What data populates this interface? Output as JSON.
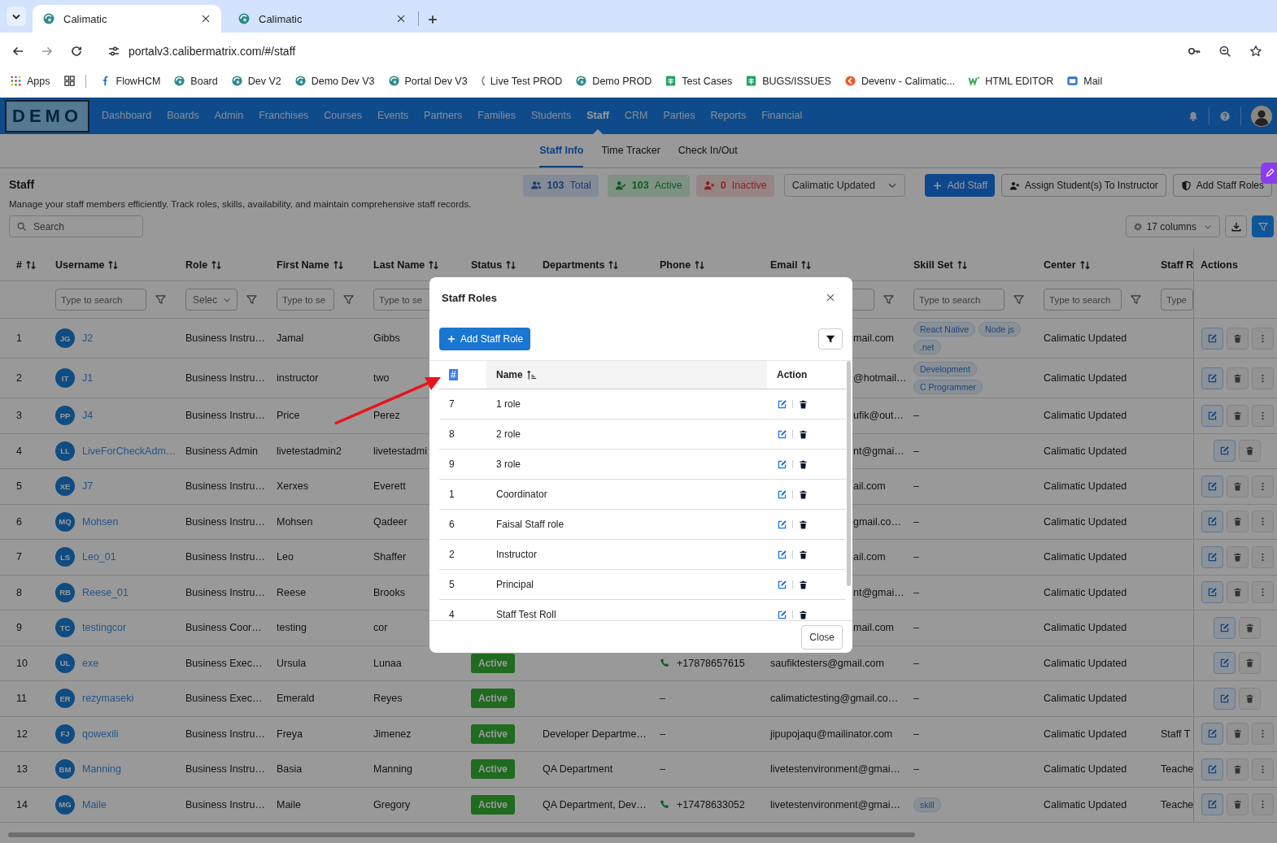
{
  "browser": {
    "tabs": [
      {
        "title": "Calimatic",
        "selected": true
      },
      {
        "title": "Calimatic",
        "selected": false
      }
    ],
    "url": "portalv3.calibermatrix.com/#/staff",
    "bookmarks": [
      {
        "kind": "apps",
        "label": "Apps"
      },
      {
        "kind": "grid"
      },
      {
        "kind": "flow",
        "label": "FlowHCM"
      },
      {
        "kind": "calimatic",
        "label": "Board"
      },
      {
        "kind": "calimatic",
        "label": "Dev V2"
      },
      {
        "kind": "calimatic",
        "label": "Demo Dev V3"
      },
      {
        "kind": "calimatic",
        "label": "Portal Dev V3"
      },
      {
        "kind": "sliver",
        "label": "Live Test PROD"
      },
      {
        "kind": "calimatic",
        "label": "Demo PROD"
      },
      {
        "kind": "sheet",
        "label": "Test Cases"
      },
      {
        "kind": "sheet",
        "label": "BUGS/ISSUES"
      },
      {
        "kind": "devenv",
        "label": "Devenv - Calimatic..."
      },
      {
        "kind": "editor",
        "label": "HTML EDITOR"
      },
      {
        "kind": "mail",
        "label": "Mail"
      }
    ]
  },
  "nav": {
    "logo": "DEMO",
    "items": [
      {
        "label": "Dashboard",
        "selected": false
      },
      {
        "label": "Boards",
        "selected": false
      },
      {
        "label": "Admin",
        "selected": false
      },
      {
        "label": "Franchises",
        "selected": false
      },
      {
        "label": "Courses",
        "selected": false
      },
      {
        "label": "Events",
        "selected": false
      },
      {
        "label": "Partners",
        "selected": false
      },
      {
        "label": "Families",
        "selected": false
      },
      {
        "label": "Students",
        "selected": false
      },
      {
        "label": "Staff",
        "selected": true
      },
      {
        "label": "CRM",
        "selected": false
      },
      {
        "label": "Parties",
        "selected": false
      },
      {
        "label": "Reports",
        "selected": false
      },
      {
        "label": "Financial",
        "selected": false
      }
    ]
  },
  "subtabs": [
    {
      "label": "Staff Info",
      "selected": true
    },
    {
      "label": "Time Tracker",
      "selected": false
    },
    {
      "label": "Check In/Out",
      "selected": false
    }
  ],
  "header": {
    "title": "Staff",
    "description": "Manage your staff members efficiently. Track roles, skills, availability, and maintain comprehensive staff records.",
    "stats": [
      {
        "kind": "total",
        "value": "103",
        "label": "Total"
      },
      {
        "kind": "active",
        "value": "103",
        "label": "Active"
      },
      {
        "kind": "inactive",
        "value": "0",
        "label": "Inactive"
      }
    ],
    "center_select": "Calimatic Updated",
    "buttons": [
      {
        "kind": "primary",
        "label": "Add Staff"
      },
      {
        "kind": "assign",
        "label": "Assign Student(s) To Instructor"
      },
      {
        "kind": "roles",
        "label": "Add Staff Roles"
      }
    ]
  },
  "toolbar": {
    "search_placeholder": "Search",
    "columns_label": "17 columns"
  },
  "table": {
    "columns": [
      {
        "label": "#",
        "sortable": true
      },
      {
        "label": "Username",
        "sortable": true
      },
      {
        "label": "Role",
        "sortable": true
      },
      {
        "label": "First Name",
        "sortable": true
      },
      {
        "label": "Last Name",
        "sortable": true
      },
      {
        "label": "Status",
        "sortable": true
      },
      {
        "label": "Departments",
        "sortable": true
      },
      {
        "label": "Phone",
        "sortable": true
      },
      {
        "label": "Email",
        "sortable": true
      },
      {
        "label": "Skill Set",
        "sortable": true
      },
      {
        "label": "Center",
        "sortable": true
      },
      {
        "label": "Staff R",
        "sortable": false
      },
      {
        "label": "Actions",
        "sortable": false
      }
    ],
    "filters": [
      {
        "kind": "none"
      },
      {
        "kind": "input",
        "placeholder": "Type to search"
      },
      {
        "kind": "select",
        "placeholder": "Selec"
      },
      {
        "kind": "input",
        "placeholder": "Type to se"
      },
      {
        "kind": "field",
        "placeholder": "Type to se"
      },
      {
        "kind": "none"
      },
      {
        "kind": "none"
      },
      {
        "kind": "none"
      },
      {
        "kind": "input"
      },
      {
        "kind": "input",
        "placeholder": "Type to search"
      },
      {
        "kind": "input",
        "placeholder": "Type to search"
      },
      {
        "kind": "bare",
        "placeholder": "Type"
      },
      {
        "kind": "none"
      }
    ],
    "rows": [
      {
        "num": "1",
        "initials": "JG",
        "username": "J2",
        "role": "Business Instru…",
        "first_name": "Jamal",
        "last_name": "Gibbs",
        "email": "mail.com",
        "skills": {
          "kind": "tags",
          "tags": [
            "React Native",
            "Node js",
            ".net"
          ]
        },
        "center": "Calimatic Updated",
        "more": true
      },
      {
        "num": "2",
        "initials": "IT",
        "username": "J1",
        "role": "Business Instru…",
        "first_name": "instructor",
        "last_name": "two",
        "email": "@hotmail…",
        "skills": {
          "kind": "tags",
          "tags": [
            "Development",
            "C Programmer"
          ]
        },
        "center": "Calimatic Updated",
        "more": true
      },
      {
        "num": "3",
        "initials": "PP",
        "username": "J4",
        "role": "Business Instru…",
        "first_name": "Price",
        "last_name": "Perez",
        "email": "ufik@out…",
        "skills": {
          "kind": "text",
          "text": "–"
        },
        "center": "Calimatic Updated",
        "more": true
      },
      {
        "num": "4",
        "initials": "LL",
        "username": "LiveForCheckAdm…",
        "role": "Business Admin",
        "first_name": "livetestadmin2",
        "last_name": "livetestadmi",
        "email": "nt@gmai…",
        "skills": {
          "kind": "text",
          "text": "–"
        },
        "center": "Calimatic Updated",
        "more": false
      },
      {
        "num": "5",
        "initials": "XE",
        "username": "J7",
        "role": "Business Instru…",
        "first_name": "Xerxes",
        "last_name": "Everett",
        "email": "ail.com",
        "skills": {
          "kind": "text",
          "text": "–"
        },
        "center": "Calimatic Updated",
        "more": true
      },
      {
        "num": "6",
        "initials": "MQ",
        "username": "Mohsen",
        "role": "Business Instru…",
        "first_name": "Mohsen",
        "last_name": "Qadeer",
        "email": "gmail.co…",
        "skills": {
          "kind": "text",
          "text": "–"
        },
        "center": "Calimatic Updated",
        "more": true
      },
      {
        "num": "7",
        "initials": "LS",
        "username": "Leo_01",
        "role": "Business Instru…",
        "first_name": "Leo",
        "last_name": "Shaffer",
        "email": "ail.com",
        "skills": {
          "kind": "text",
          "text": "–"
        },
        "center": "Calimatic Updated",
        "more": true
      },
      {
        "num": "8",
        "initials": "RB",
        "username": "Reese_01",
        "role": "Business Instru…",
        "first_name": "Reese",
        "last_name": "Brooks",
        "email": "nt@gmai…",
        "skills": {
          "kind": "text",
          "text": "–"
        },
        "center": "Calimatic Updated",
        "more": true
      },
      {
        "num": "9",
        "initials": "TC",
        "username": "testingcor",
        "role": "Business Coor…",
        "first_name": "testing",
        "last_name": "cor",
        "email": "mail.com",
        "skills": {
          "kind": "text",
          "text": "–"
        },
        "center": "Calimatic Updated",
        "more": false
      },
      {
        "num": "10",
        "initials": "UL",
        "username": "exe",
        "role": "Business Exec…",
        "first_name": "Ursula",
        "last_name": "Lunaa",
        "status": "Active",
        "phone": {
          "kind": "number",
          "text": "+17878657615"
        },
        "email": "saufiktesters@gmail.com",
        "skills": {
          "kind": "text",
          "text": "–"
        },
        "center": "Calimatic Updated",
        "more": false
      },
      {
        "num": "11",
        "initials": "ER",
        "username": "rezymaseki",
        "role": "Business Exec…",
        "first_name": "Emerald",
        "last_name": "Reyes",
        "status": "Active",
        "phone": {
          "kind": "text",
          "text": "–"
        },
        "email": "calimatictesting@gmail.co…",
        "skills": {
          "kind": "text",
          "text": "–"
        },
        "center": "Calimatic Updated",
        "more": false
      },
      {
        "num": "12",
        "initials": "FJ",
        "username": "qowexili",
        "role": "Business Instru…",
        "first_name": "Freya",
        "last_name": "Jimenez",
        "status": "Active",
        "department": "Developer Departme…",
        "phone": {
          "kind": "text",
          "text": "–"
        },
        "email": "jipupojaqu@mailinator.com",
        "skills": {
          "kind": "text",
          "text": "–"
        },
        "center": "Calimatic Updated",
        "staff_role": "Staff T",
        "more": true
      },
      {
        "num": "13",
        "initials": "BM",
        "username": "Manning",
        "role": "Business Instru…",
        "first_name": "Basia",
        "last_name": "Manning",
        "status": "Active",
        "department": "QA Department",
        "phone": {
          "kind": "text",
          "text": "–"
        },
        "email": "livetestenvironment@gmai…",
        "skills": {
          "kind": "text",
          "text": "–"
        },
        "center": "Calimatic Updated",
        "staff_role": "Teache",
        "more": true
      },
      {
        "num": "14",
        "initials": "MG",
        "username": "Maile",
        "role": "Business Instru…",
        "first_name": "Maile",
        "last_name": "Gregory",
        "status": "Active",
        "department": "QA Department, Dev…",
        "phone": {
          "kind": "number",
          "text": "+17478633052"
        },
        "email": "livetestenvironment@gmai…",
        "skills": {
          "kind": "tags",
          "tags": [
            "skill"
          ]
        },
        "center": "Calimatic Updated",
        "staff_role": "Teache",
        "more": true
      }
    ]
  },
  "modal": {
    "title": "Staff Roles",
    "add_label": "Add Staff Role",
    "columns": [
      {
        "label": "#"
      },
      {
        "label": "Name"
      },
      {
        "label": "Action"
      }
    ],
    "rows": [
      {
        "num": "7",
        "name": "1 role"
      },
      {
        "num": "8",
        "name": "2 role"
      },
      {
        "num": "9",
        "name": "3 role"
      },
      {
        "num": "1",
        "name": "Coordinator"
      },
      {
        "num": "6",
        "name": "Faisal Staff role"
      },
      {
        "num": "2",
        "name": "Instructor"
      },
      {
        "num": "5",
        "name": "Principal"
      },
      {
        "num": "4",
        "name": "Staff Test Roll"
      }
    ],
    "close_label": "Close"
  }
}
